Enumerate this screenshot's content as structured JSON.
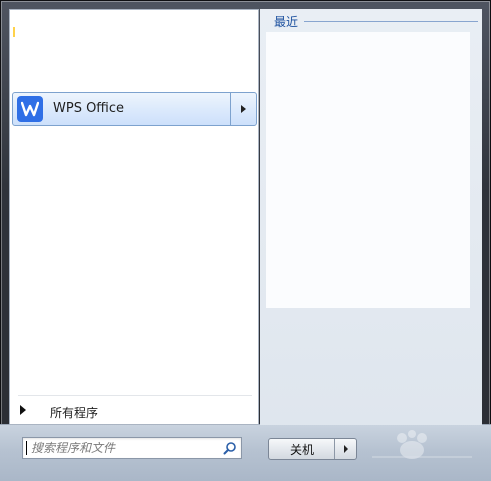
{
  "start_menu": {
    "pinned": {
      "items": [
        {
          "label": "WPS Office",
          "icon": "wps-office-icon"
        }
      ]
    },
    "all_programs_label": "所有程序",
    "recent": {
      "header": "最近",
      "items": []
    },
    "search": {
      "placeholder": "搜索程序和文件",
      "value": "",
      "icon": "search-icon"
    },
    "shutdown": {
      "label": "关机",
      "menu_icon": "chevron-right-icon"
    }
  },
  "colors": {
    "accent": "#2f6fe6",
    "recent_header": "#1a4f9e",
    "selection_border": "#7da2ce"
  }
}
